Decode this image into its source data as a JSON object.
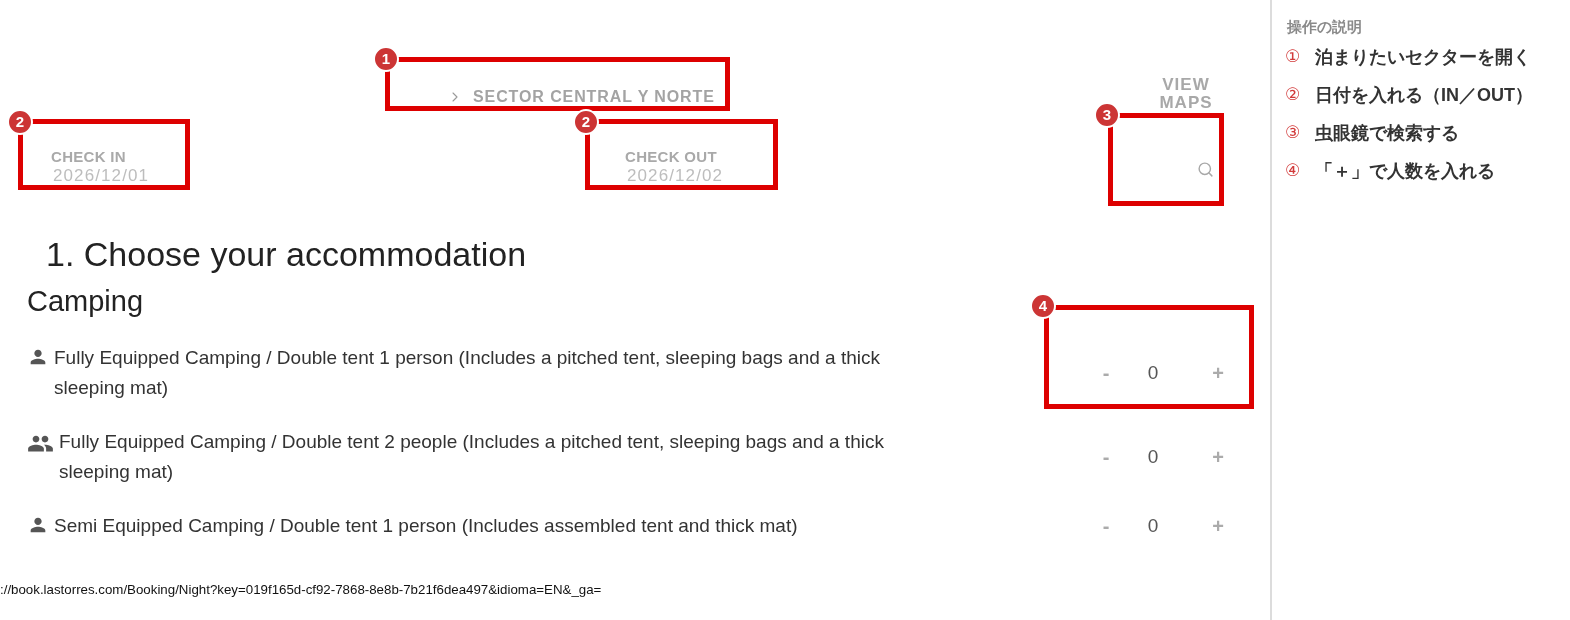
{
  "breadcrumb": {
    "label": "SECTOR CENTRAL Y NORTE"
  },
  "view_maps": "VIEW MAPS",
  "check_in": {
    "label": "CHECK IN",
    "value": "2026/12/01"
  },
  "check_out": {
    "label": "CHECK OUT",
    "value": "2026/12/02"
  },
  "heading": "1. Choose your accommodation",
  "section": "Camping",
  "options": [
    {
      "kind": "single",
      "label": "Fully Equipped Camping / Double tent 1 person (Includes a pitched tent, sleeping bags and a thick sleeping mat)",
      "minus": "-",
      "count": "0",
      "plus": "+"
    },
    {
      "kind": "pair",
      "label": "Fully Equipped Camping / Double tent 2 people (Includes a pitched tent, sleeping bags and a thick sleeping mat)",
      "minus": "-",
      "count": "0",
      "plus": "+"
    },
    {
      "kind": "single",
      "label": "Semi Equipped Camping / Double tent 1 person (Includes assembled tent and thick mat)",
      "minus": "-",
      "count": "0",
      "plus": "+"
    }
  ],
  "status_url": "://book.lastorres.com/Booking/Night?key=019f165d-cf92-7868-8e8b-7b21f6dea497&idioma=EN&_ga=",
  "sidebar": {
    "title": "操作の説明",
    "steps": [
      {
        "marker": "①",
        "text": "泊まりたいセクターを開く"
      },
      {
        "marker": "②",
        "text": "日付を入れる（IN／OUT）"
      },
      {
        "marker": "③",
        "text": "虫眼鏡で検索する"
      },
      {
        "marker": "④",
        "text": "「＋」で人数を入れる"
      }
    ]
  },
  "annotations": [
    {
      "number": "1"
    },
    {
      "number": "2"
    },
    {
      "number": "2"
    },
    {
      "number": "3"
    },
    {
      "number": "4"
    }
  ]
}
